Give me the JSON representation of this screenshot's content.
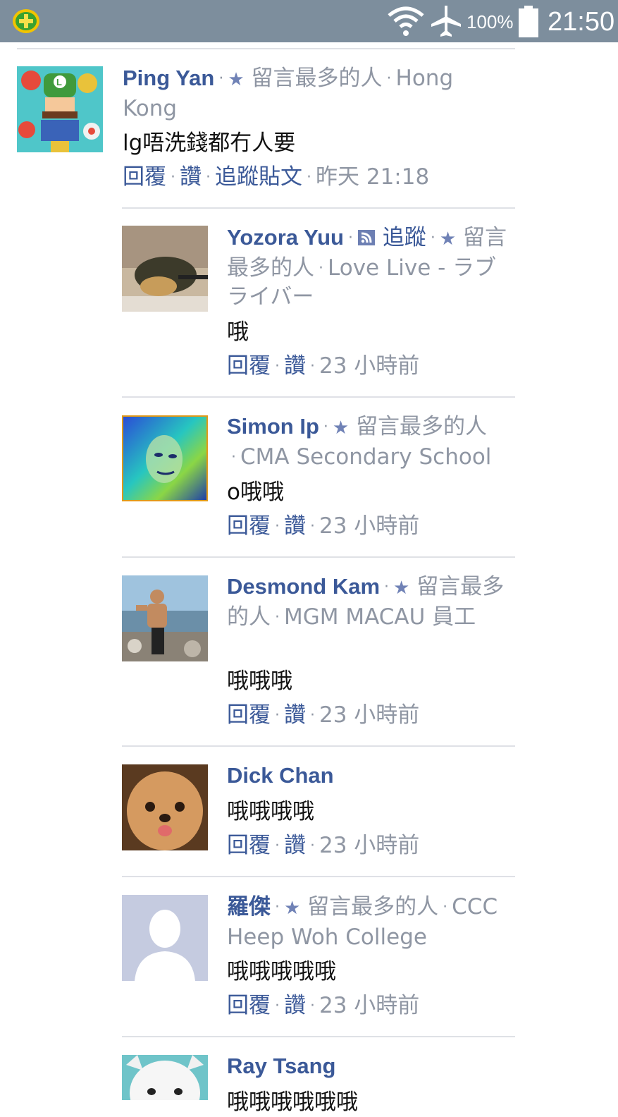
{
  "status_bar": {
    "battery_text": "100%",
    "time": "21:50"
  },
  "actions": {
    "reply": "回覆",
    "like": "讚",
    "follow_post": "追蹤貼文",
    "follow": "追蹤"
  },
  "comments": [
    {
      "name": "Ping Yan",
      "badge": "留言最多的人",
      "meta": "Hong Kong",
      "text": "lg唔洗錢都冇人要",
      "time": "昨天 21:18"
    },
    {
      "name": "Yozora Yuu",
      "badge": "留言最多的人",
      "meta": "Love Live - ラブライバー",
      "text": "哦",
      "time": "23 小時前"
    },
    {
      "name": "Simon Ip",
      "badge": "留言最多的人",
      "meta": "CMA Secondary School",
      "text": "o哦哦",
      "time": "23 小時前"
    },
    {
      "name": "Desmond Kam",
      "badge": "留言最多的人",
      "meta": "MGM MACAU 員工",
      "text": "哦哦哦",
      "time": "23 小時前"
    },
    {
      "name": "Dick Chan",
      "text": "哦哦哦哦",
      "time": "23 小時前"
    },
    {
      "name": "羅傑",
      "badge": "留言最多的人",
      "meta": "CCC Heep Woh College",
      "text": "哦哦哦哦哦",
      "time": "23 小時前"
    },
    {
      "name": "Ray Tsang",
      "text": "哦哦哦哦哦哦"
    }
  ]
}
